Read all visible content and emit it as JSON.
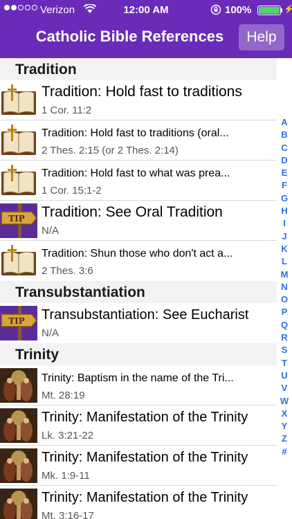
{
  "status_bar": {
    "carrier": "Verizon",
    "time": "12:00 AM",
    "battery": "100%"
  },
  "nav": {
    "title": "Catholic Bible References",
    "help_label": "Help"
  },
  "colors": {
    "header": "#6a2bb8",
    "index_letters": "#2a6ee8",
    "section_bg": "#f2f2f4"
  },
  "sections": [
    {
      "title": "Tradition",
      "rows": [
        {
          "title": "Tradition: Hold fast to traditions",
          "ref": "1 Cor. 11:2",
          "icon": "bible-icon"
        },
        {
          "title": "Tradition: Hold fast to traditions (oral...",
          "ref": "2 Thes. 2:15 (or 2 Thes. 2:14)",
          "icon": "bible-icon"
        },
        {
          "title": "Tradition: Hold fast to what was prea...",
          "ref": "1 Cor. 15:1-2",
          "icon": "bible-icon"
        },
        {
          "title": "Tradition: See Oral Tradition",
          "ref": "N/A",
          "icon": "tip-sign-icon"
        },
        {
          "title": "Tradition: Shun those who don't act a...",
          "ref": "2 Thes. 3:6",
          "icon": "bible-icon"
        }
      ]
    },
    {
      "title": "Transubstantiation",
      "rows": [
        {
          "title": "Transubstantiation: See Eucharist",
          "ref": "N/A",
          "icon": "tip-sign-icon"
        }
      ]
    },
    {
      "title": "Trinity",
      "rows": [
        {
          "title": "Trinity: Baptism in the name of the Tri...",
          "ref": "Mt. 28:19",
          "icon": "trinity-painting-icon"
        },
        {
          "title": "Trinity: Manifestation of the Trinity",
          "ref": "Lk. 3:21-22",
          "icon": "trinity-painting-icon"
        },
        {
          "title": "Trinity: Manifestation of the Trinity",
          "ref": "Mk. 1:9-11",
          "icon": "trinity-painting-icon"
        },
        {
          "title": "Trinity: Manifestation of the Trinity",
          "ref": "Mt. 3:16-17",
          "icon": "trinity-painting-icon"
        }
      ]
    }
  ],
  "index_letters": [
    "A",
    "B",
    "C",
    "D",
    "E",
    "F",
    "G",
    "H",
    "I",
    "J",
    "K",
    "L",
    "M",
    "N",
    "O",
    "P",
    "Q",
    "R",
    "S",
    "T",
    "U",
    "V",
    "W",
    "X",
    "Y",
    "Z",
    "#"
  ]
}
